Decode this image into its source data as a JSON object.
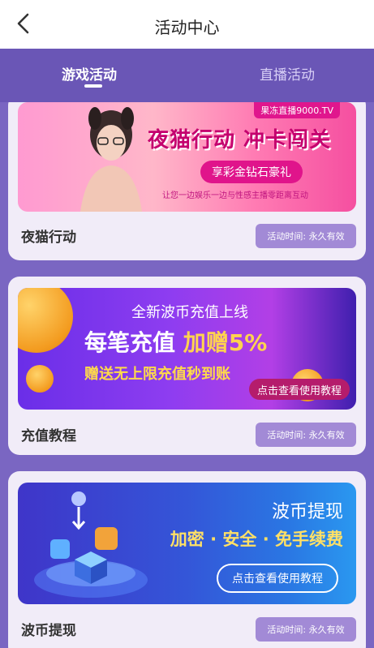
{
  "header": {
    "title": "活动中心",
    "back_icon": "back-chevron-icon"
  },
  "tabs": [
    {
      "label": "游戏活动",
      "active": true
    },
    {
      "label": "直播活动",
      "active": false
    }
  ],
  "colors": {
    "primary": "#7a66c2",
    "tabbar": "#6a56b6",
    "card": "#f1ecf8",
    "badge": "#a28ad6"
  },
  "cards": [
    {
      "title": "夜猫行动",
      "badge": "活动时间: 永久有效",
      "banner": {
        "brand": "果冻直播9000.TV",
        "headline": "夜猫行动 冲卡闯关",
        "pill": "享彩金钻石豪礼",
        "sub": "让您一边娱乐一边与性感主播零距离互动"
      }
    },
    {
      "title": "充值教程",
      "badge": "活动时间: 永久有效",
      "banner": {
        "top": "全新波币充值上线",
        "main_a": "每笔充值",
        "main_b": "加赠5%",
        "sub": "赠送无上限充值秒到账",
        "button": "点击查看使用教程"
      }
    },
    {
      "title": "波币提现",
      "badge": "活动时间: 永久有效",
      "banner": {
        "title": "波币提现",
        "main": "加密 · 安全 · 免手续费",
        "button": "点击查看使用教程"
      }
    }
  ]
}
